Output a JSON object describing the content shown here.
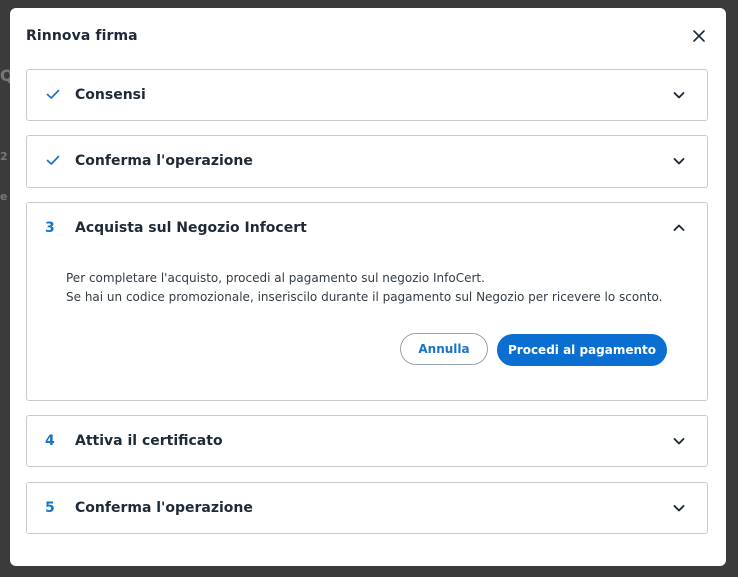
{
  "modal": {
    "title": "Rinnova firma"
  },
  "background_fragments": [
    "Q",
    "2",
    "e"
  ],
  "sections": [
    {
      "marker": "✓",
      "title": "Consensi",
      "state": "completed",
      "expanded": false
    },
    {
      "marker": "✓",
      "title": "Conferma l'operazione",
      "state": "completed",
      "expanded": false
    },
    {
      "marker": "3",
      "title": "Acquista sul Negozio Infocert",
      "state": "active",
      "expanded": true,
      "body_line_1": "Per completare l'acquisto, procedi al pagamento sul negozio InfoCert.",
      "body_line_2": "Se hai un codice promozionale, inseriscilo durante il pagamento sul Negozio per ricevere lo sconto.",
      "cancel_label": "Annulla",
      "proceed_label": "Procedi al pagamento"
    },
    {
      "marker": "4",
      "title": "Attiva il certificato",
      "state": "pending",
      "expanded": false
    },
    {
      "marker": "5",
      "title": "Conferma l'operazione",
      "state": "pending",
      "expanded": false
    }
  ],
  "colors": {
    "accent": "#0b6fd1",
    "marker": "#1a73c9",
    "title_text": "#1f2a37",
    "border": "#c8ccd1",
    "backdrop": "#3b3b3b"
  },
  "icons": {
    "close": "close-icon",
    "check": "check-icon",
    "chevron_down": "chevron-down-icon",
    "chevron_up": "chevron-up-icon"
  }
}
